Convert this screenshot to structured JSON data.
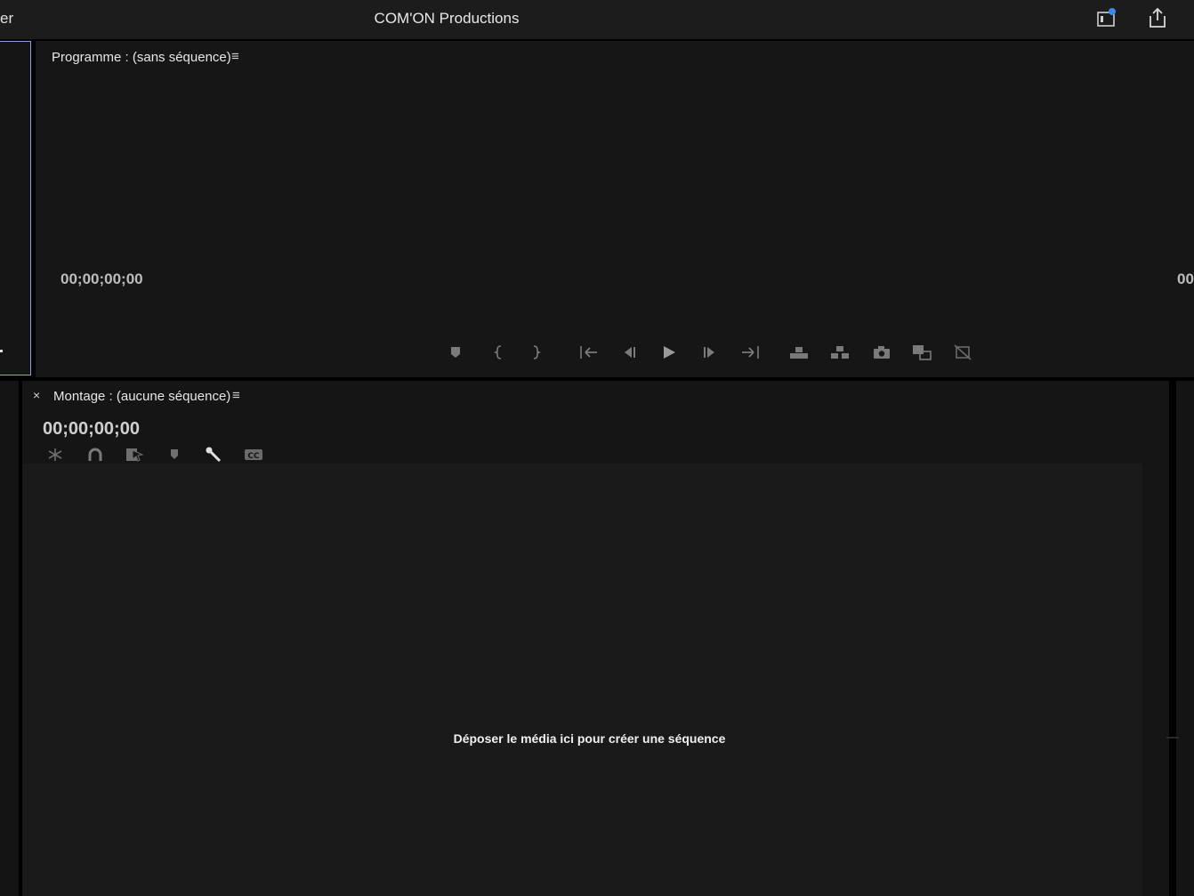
{
  "titlebar": {
    "edge_label": "er",
    "title": "COM'ON Productions",
    "icons": [
      "quick-export-icon",
      "share-icon"
    ],
    "accent_color": "#3a8be8"
  },
  "program_monitor": {
    "title": "Programme : (sans séquence)",
    "menu_glyph": "≡",
    "timecode_left": "00;00;00;00",
    "timecode_right": "00",
    "transport_icons": [
      "add-marker-icon",
      "mark-in-icon",
      "mark-out-icon",
      "go-to-in-icon",
      "step-back-icon",
      "play-icon",
      "step-forward-icon",
      "go-to-out-icon",
      "lift-icon",
      "extract-icon",
      "export-frame-icon",
      "comparison-view-icon",
      "proxy-toggle-icon"
    ]
  },
  "timeline": {
    "close_glyph": "×",
    "title": "Montage : (aucune séquence)",
    "menu_glyph": "≡",
    "timecode": "00;00;00;00",
    "tool_icons": [
      "nest-icon",
      "snap-icon",
      "linked-selection-icon",
      "add-marker-icon",
      "settings-wrench-icon",
      "captions-icon"
    ],
    "drop_message": "Déposer le média ici pour créer une séquence"
  }
}
